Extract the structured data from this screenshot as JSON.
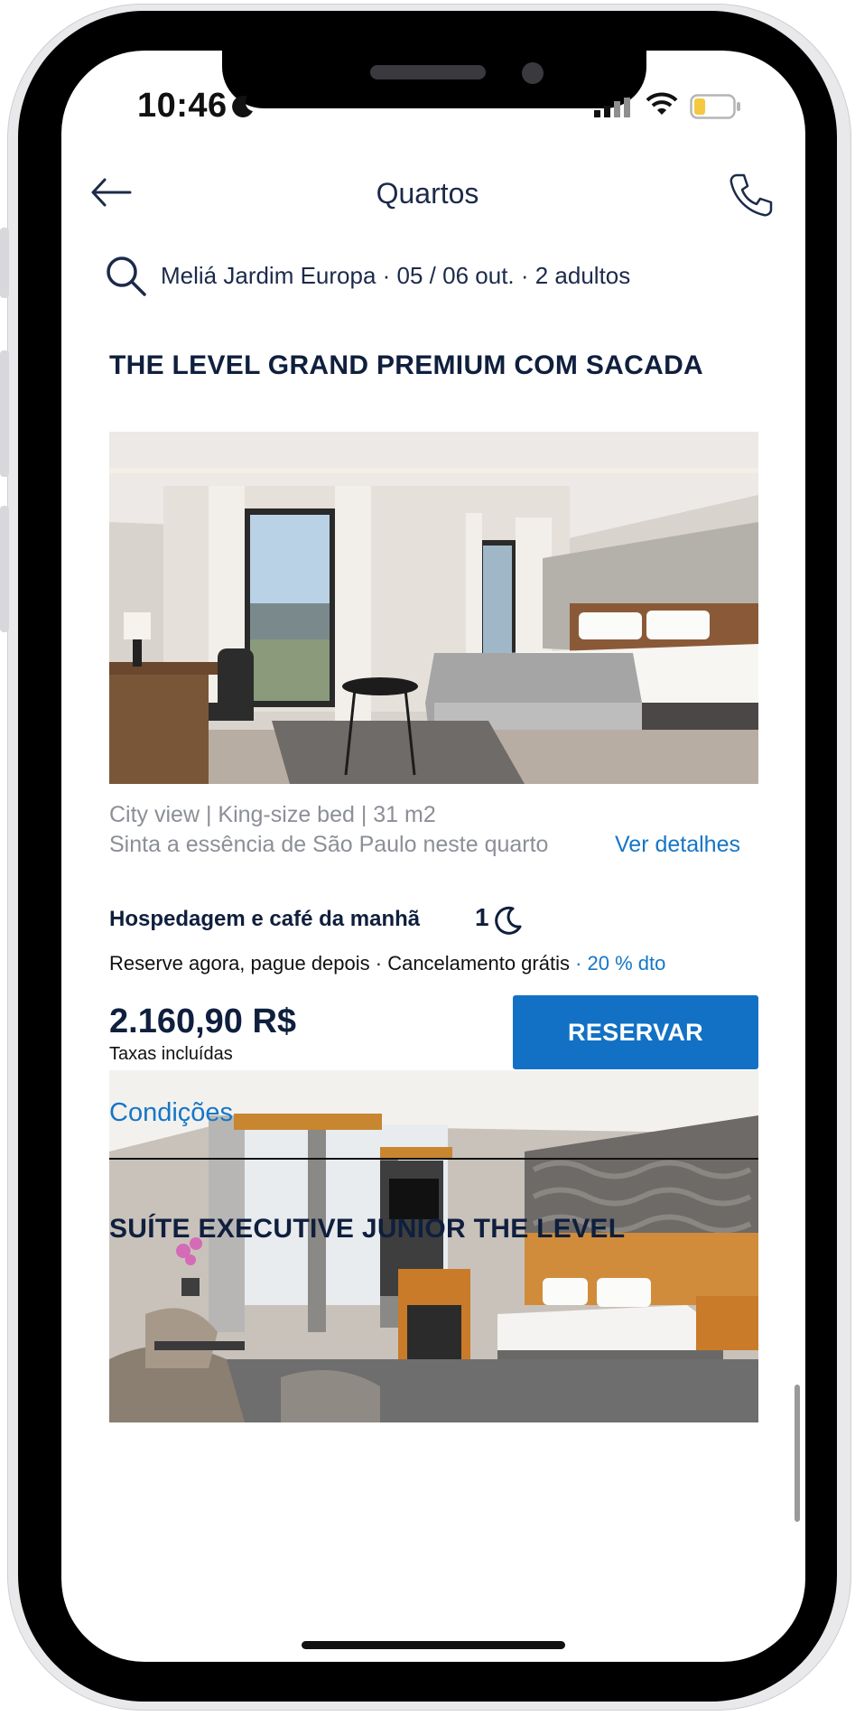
{
  "status_bar": {
    "time": "10:46"
  },
  "header": {
    "title": "Quartos"
  },
  "search": {
    "summary": "Meliá Jardim Europa · 05 / 06 out. · 2 adultos"
  },
  "rooms": [
    {
      "title": "THE LEVEL GRAND PREMIUM COM SACADA",
      "features": "City view | King-size bed | 31 m2",
      "description": "Sinta a essência de São Paulo neste quarto",
      "details_label": "Ver detalhes",
      "rate_name": "Hospedagem e café da manhã",
      "nights": "1",
      "policy": "Reserve agora, pague depois · Cancelamento grátis",
      "discount": " · 20 % dto",
      "price": "2.160,90 R$",
      "taxes": "Taxas incluídas",
      "reserve_label": "RESERVAR",
      "conditions_label": "Condições"
    },
    {
      "title": "SUÍTE EXECUTIVE JUNIOR THE LEVEL"
    }
  ],
  "colors": {
    "accent": "#1271c4",
    "link": "#1576c6",
    "title": "#0f1f3d"
  }
}
